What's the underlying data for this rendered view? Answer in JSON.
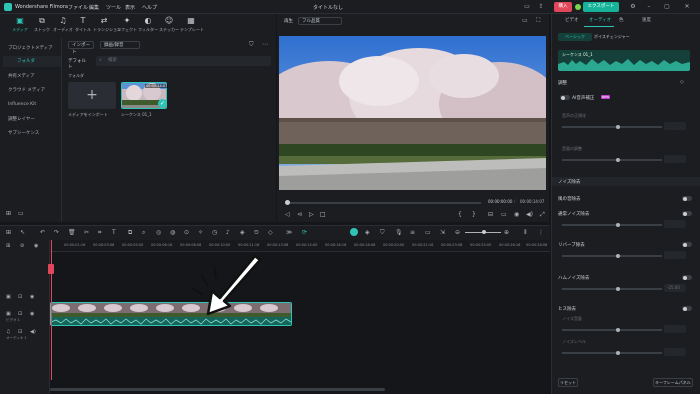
{
  "titlebar": {
    "app_name": "Wondershare Filmora",
    "menu": [
      "ファイル",
      "編集",
      "ツール",
      "表示",
      "ヘルプ"
    ],
    "doc_title": "タイトルなし",
    "buy_label": "購入",
    "export_label": "エクスポート"
  },
  "toolbar": {
    "items": [
      {
        "label": "メディア",
        "icon": "media-icon"
      },
      {
        "label": "ストック",
        "icon": "stock-icon"
      },
      {
        "label": "オーディオ",
        "icon": "audio-icon"
      },
      {
        "label": "タイトル",
        "icon": "title-icon"
      },
      {
        "label": "トランジション",
        "icon": "transition-icon"
      },
      {
        "label": "エフェクト",
        "icon": "effect-icon"
      },
      {
        "label": "フィルター",
        "icon": "filter-icon"
      },
      {
        "label": "ステッカー",
        "icon": "sticker-icon"
      },
      {
        "label": "テンプレート",
        "icon": "template-icon"
      }
    ]
  },
  "sidebar": {
    "items": [
      {
        "label": "プロジェクトメディア",
        "active": false
      },
      {
        "label": "フォルダ",
        "active": true,
        "sub": true
      },
      {
        "label": "共有メディア"
      },
      {
        "label": "クラウド メディア"
      },
      {
        "label": "Influence Kit"
      },
      {
        "label": "調整レイヤー"
      },
      {
        "label": "サブシーケンス"
      }
    ]
  },
  "media": {
    "import_label": "インポート",
    "record_label": "録画/録音",
    "default_label": "デフォルト",
    "search_placeholder": "検索",
    "folder_label": "フォルダ",
    "import_tile_label": "メディアをインポート",
    "clip_name": "シーケンス 01_1",
    "clip_duration": "00:00:14:07"
  },
  "player": {
    "tab": "再生",
    "quality": "フル品質",
    "current_time": "00:00:00:00",
    "total_time": "00:00:14:07"
  },
  "inspector": {
    "tabs": [
      "ビデオ",
      "オーディオ",
      "色",
      "速度"
    ],
    "active_tab": "オーディオ",
    "subtabs": [
      "ベーシック",
      "ボイスチェンジャー"
    ],
    "clip_label": "シーケンス 01_1",
    "adjust_label": "調整",
    "ai_voice_label": "AI音声補正",
    "ai_badge": "NEW",
    "volume_label": "音声の正規化",
    "fade_label": "音量の調整",
    "noise_section": "ノイズ除去",
    "wind_label": "風の音除去",
    "normal_noise_label": "通常ノイズ除去",
    "reverb_label": "リバーブ除去",
    "hum_label": "ハムノイズ除去",
    "hiss_label": "ヒス除去",
    "noise_vol_label": "ノイズ音量",
    "denoise_level_label": "ノイズレベル",
    "hum_value": "-25.00",
    "reset_label": "リセット",
    "keyframe_label": "キーフレームパネル"
  },
  "timeline": {
    "ruler_ticks": [
      "00:00:00:00",
      "00:00:01:16",
      "00:00:03:08",
      "00:00:05:00",
      "00:00:06:16",
      "00:00:08:08",
      "00:00:10:00",
      "00:00:11:16",
      "00:00:13:08",
      "00:00:15:00",
      "00:00:16:16",
      "00:00:18:08",
      "00:00:20:00",
      "00:00:21:16",
      "00:00:23:08",
      "00:00:25:00",
      "00:00:26:16",
      "00:00:28:08"
    ],
    "track_video_label": "ビデオ 1",
    "track_audio_label": "オーディオ 1"
  },
  "colors": {
    "accent": "#2ec4b6",
    "buy": "#e0475b",
    "playhead": "#e0475b"
  }
}
